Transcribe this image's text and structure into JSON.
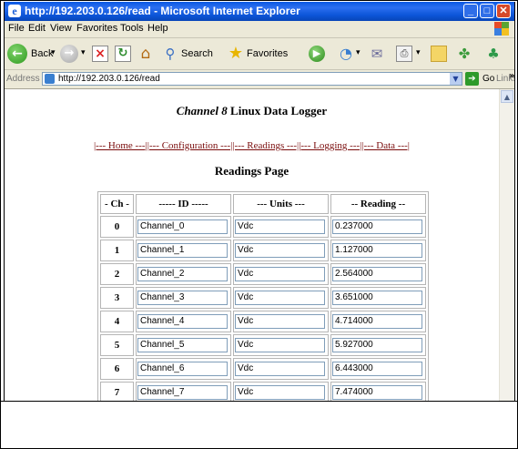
{
  "browser": {
    "title": "http://192.203.0.126/read - Microsoft Internet Explorer",
    "menu": [
      "File",
      "Edit",
      "View",
      "Favorites",
      "Tools",
      "Help"
    ],
    "toolbar": {
      "back_label": "Back",
      "search_label": "Search",
      "favorites_label": "Favorites"
    },
    "address": {
      "label": "Address",
      "url": "http://192.203.0.126/read",
      "go_label": "Go",
      "links_label": "Links"
    }
  },
  "page": {
    "title_italic": "Channel 8",
    "title_rest": "Linux Data Logger",
    "nav": [
      "|--- Home ---|",
      "|--- Configuration ---|",
      "|--- Readings ---|",
      "|--- Logging ---|",
      "|--- Data ---|"
    ],
    "heading": "Readings Page",
    "table": {
      "headers": [
        "- Ch -",
        "----- ID -----",
        "--- Units ---",
        "-- Reading --"
      ],
      "rows": [
        {
          "ch": "0",
          "id": "Channel_0",
          "units": "Vdc",
          "reading": "0.237000"
        },
        {
          "ch": "1",
          "id": "Channel_1",
          "units": "Vdc",
          "reading": "1.127000"
        },
        {
          "ch": "2",
          "id": "Channel_2",
          "units": "Vdc",
          "reading": "2.564000"
        },
        {
          "ch": "3",
          "id": "Channel_3",
          "units": "Vdc",
          "reading": "3.651000"
        },
        {
          "ch": "4",
          "id": "Channel_4",
          "units": "Vdc",
          "reading": "4.714000"
        },
        {
          "ch": "5",
          "id": "Channel_5",
          "units": "Vdc",
          "reading": "5.927000"
        },
        {
          "ch": "6",
          "id": "Channel_6",
          "units": "Vdc",
          "reading": "6.443000"
        },
        {
          "ch": "7",
          "id": "Channel_7",
          "units": "Vdc",
          "reading": "7.474000"
        }
      ]
    }
  },
  "colors": {
    "titlebar": "#0c55d8",
    "nav_link": "#7a0c0c",
    "chrome": "#ece9d8"
  }
}
